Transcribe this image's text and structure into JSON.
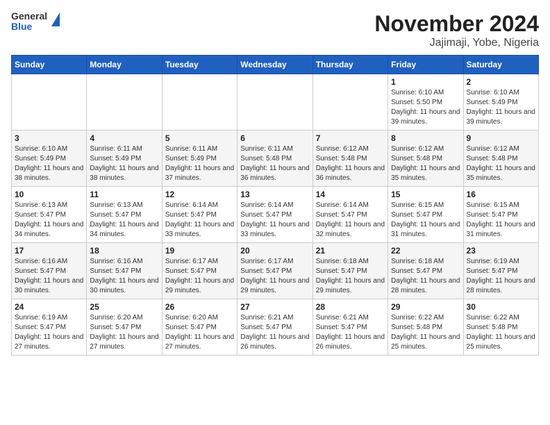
{
  "header": {
    "logo": {
      "line1": "General",
      "line2": "Blue"
    },
    "title": "November 2024",
    "subtitle": "Jajimaji, Yobe, Nigeria"
  },
  "days_of_week": [
    "Sunday",
    "Monday",
    "Tuesday",
    "Wednesday",
    "Thursday",
    "Friday",
    "Saturday"
  ],
  "weeks": [
    [
      {
        "day": "",
        "info": ""
      },
      {
        "day": "",
        "info": ""
      },
      {
        "day": "",
        "info": ""
      },
      {
        "day": "",
        "info": ""
      },
      {
        "day": "",
        "info": ""
      },
      {
        "day": "1",
        "info": "Sunrise: 6:10 AM\nSunset: 5:50 PM\nDaylight: 11 hours and 39 minutes."
      },
      {
        "day": "2",
        "info": "Sunrise: 6:10 AM\nSunset: 5:49 PM\nDaylight: 11 hours and 39 minutes."
      }
    ],
    [
      {
        "day": "3",
        "info": "Sunrise: 6:10 AM\nSunset: 5:49 PM\nDaylight: 11 hours and 38 minutes."
      },
      {
        "day": "4",
        "info": "Sunrise: 6:11 AM\nSunset: 5:49 PM\nDaylight: 11 hours and 38 minutes."
      },
      {
        "day": "5",
        "info": "Sunrise: 6:11 AM\nSunset: 5:49 PM\nDaylight: 11 hours and 37 minutes."
      },
      {
        "day": "6",
        "info": "Sunrise: 6:11 AM\nSunset: 5:48 PM\nDaylight: 11 hours and 36 minutes."
      },
      {
        "day": "7",
        "info": "Sunrise: 6:12 AM\nSunset: 5:48 PM\nDaylight: 11 hours and 36 minutes."
      },
      {
        "day": "8",
        "info": "Sunrise: 6:12 AM\nSunset: 5:48 PM\nDaylight: 11 hours and 35 minutes."
      },
      {
        "day": "9",
        "info": "Sunrise: 6:12 AM\nSunset: 5:48 PM\nDaylight: 11 hours and 35 minutes."
      }
    ],
    [
      {
        "day": "10",
        "info": "Sunrise: 6:13 AM\nSunset: 5:47 PM\nDaylight: 11 hours and 34 minutes."
      },
      {
        "day": "11",
        "info": "Sunrise: 6:13 AM\nSunset: 5:47 PM\nDaylight: 11 hours and 34 minutes."
      },
      {
        "day": "12",
        "info": "Sunrise: 6:14 AM\nSunset: 5:47 PM\nDaylight: 11 hours and 33 minutes."
      },
      {
        "day": "13",
        "info": "Sunrise: 6:14 AM\nSunset: 5:47 PM\nDaylight: 11 hours and 33 minutes."
      },
      {
        "day": "14",
        "info": "Sunrise: 6:14 AM\nSunset: 5:47 PM\nDaylight: 11 hours and 32 minutes."
      },
      {
        "day": "15",
        "info": "Sunrise: 6:15 AM\nSunset: 5:47 PM\nDaylight: 11 hours and 31 minutes."
      },
      {
        "day": "16",
        "info": "Sunrise: 6:15 AM\nSunset: 5:47 PM\nDaylight: 11 hours and 31 minutes."
      }
    ],
    [
      {
        "day": "17",
        "info": "Sunrise: 6:16 AM\nSunset: 5:47 PM\nDaylight: 11 hours and 30 minutes."
      },
      {
        "day": "18",
        "info": "Sunrise: 6:16 AM\nSunset: 5:47 PM\nDaylight: 11 hours and 30 minutes."
      },
      {
        "day": "19",
        "info": "Sunrise: 6:17 AM\nSunset: 5:47 PM\nDaylight: 11 hours and 29 minutes."
      },
      {
        "day": "20",
        "info": "Sunrise: 6:17 AM\nSunset: 5:47 PM\nDaylight: 11 hours and 29 minutes."
      },
      {
        "day": "21",
        "info": "Sunrise: 6:18 AM\nSunset: 5:47 PM\nDaylight: 11 hours and 29 minutes."
      },
      {
        "day": "22",
        "info": "Sunrise: 6:18 AM\nSunset: 5:47 PM\nDaylight: 11 hours and 28 minutes."
      },
      {
        "day": "23",
        "info": "Sunrise: 6:19 AM\nSunset: 5:47 PM\nDaylight: 11 hours and 28 minutes."
      }
    ],
    [
      {
        "day": "24",
        "info": "Sunrise: 6:19 AM\nSunset: 5:47 PM\nDaylight: 11 hours and 27 minutes."
      },
      {
        "day": "25",
        "info": "Sunrise: 6:20 AM\nSunset: 5:47 PM\nDaylight: 11 hours and 27 minutes."
      },
      {
        "day": "26",
        "info": "Sunrise: 6:20 AM\nSunset: 5:47 PM\nDaylight: 11 hours and 27 minutes."
      },
      {
        "day": "27",
        "info": "Sunrise: 6:21 AM\nSunset: 5:47 PM\nDaylight: 11 hours and 26 minutes."
      },
      {
        "day": "28",
        "info": "Sunrise: 6:21 AM\nSunset: 5:47 PM\nDaylight: 11 hours and 26 minutes."
      },
      {
        "day": "29",
        "info": "Sunrise: 6:22 AM\nSunset: 5:48 PM\nDaylight: 11 hours and 25 minutes."
      },
      {
        "day": "30",
        "info": "Sunrise: 6:22 AM\nSunset: 5:48 PM\nDaylight: 11 hours and 25 minutes."
      }
    ]
  ]
}
